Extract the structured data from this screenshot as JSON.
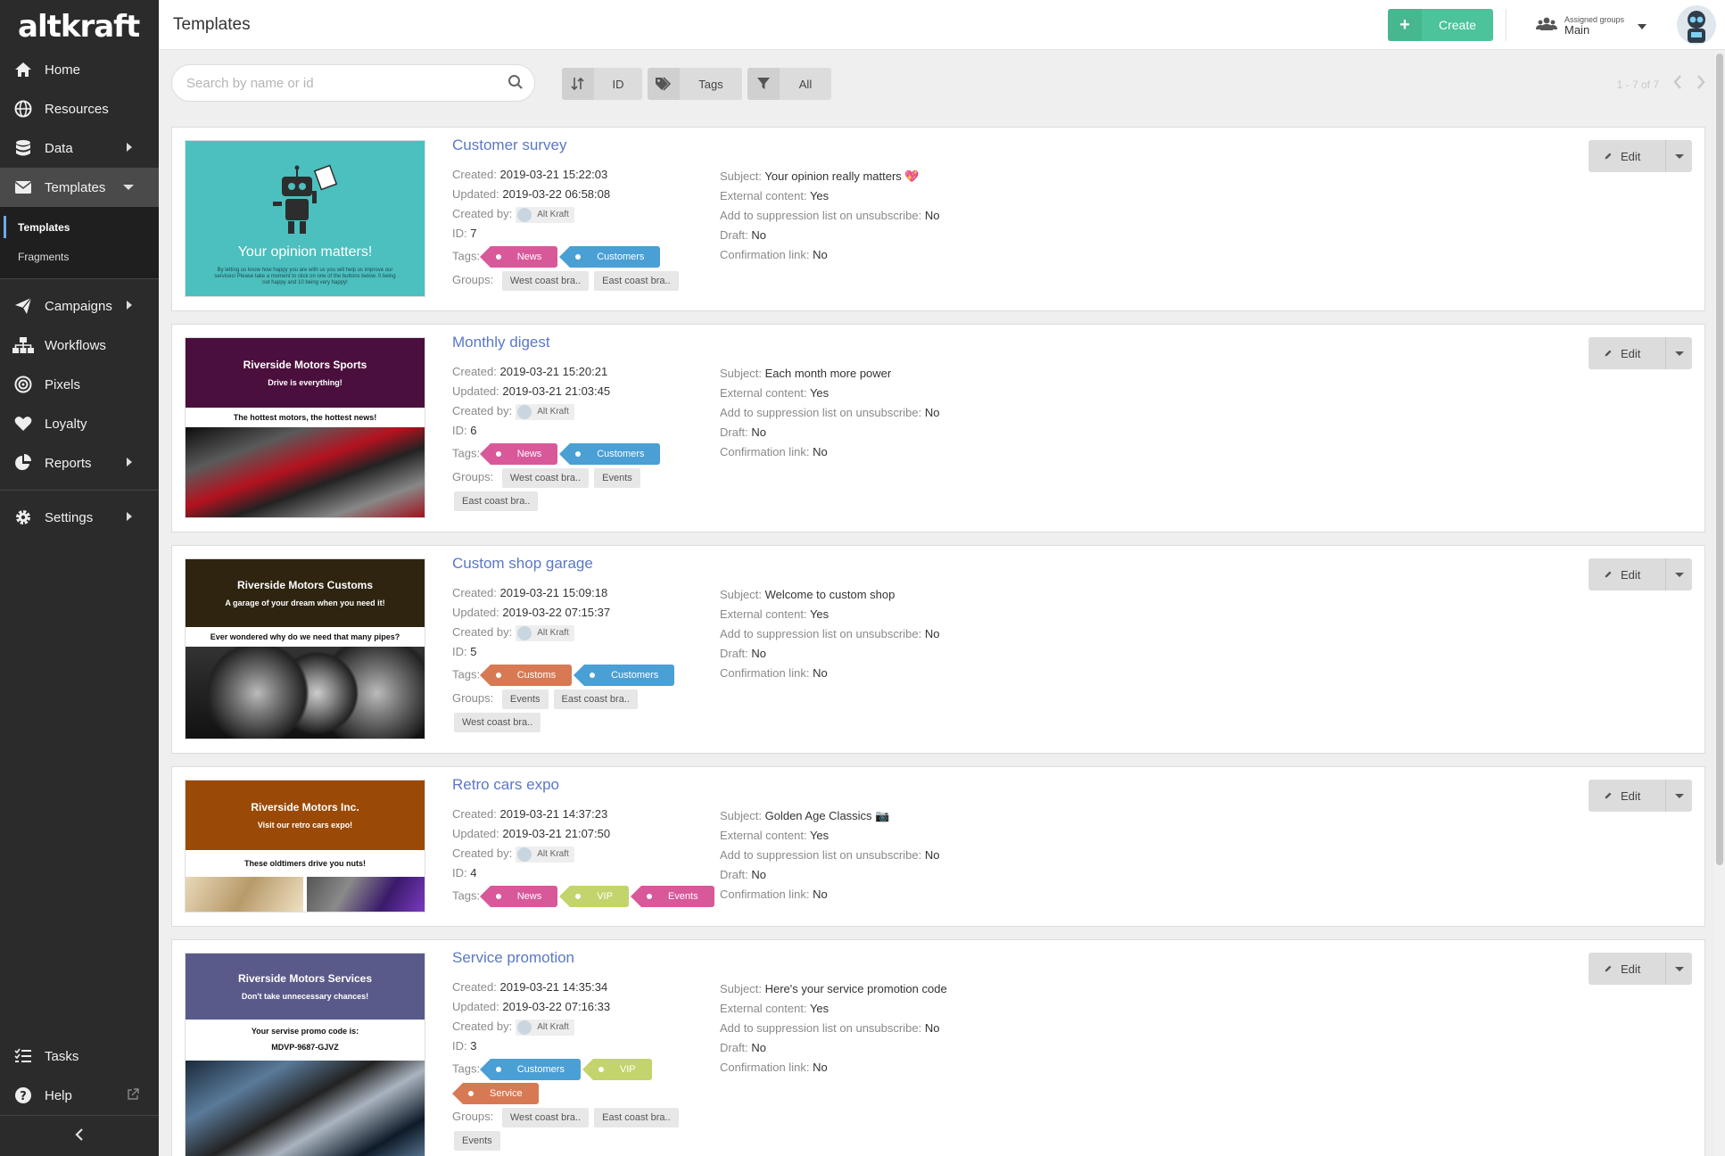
{
  "app": {
    "logo": "altkraft",
    "page_title": "Templates"
  },
  "sidebar": {
    "items": [
      {
        "label": "Home",
        "icon": "home-icon"
      },
      {
        "label": "Resources",
        "icon": "globe-icon"
      },
      {
        "label": "Data",
        "icon": "database-icon"
      },
      {
        "label": "Templates",
        "icon": "envelope-icon"
      },
      {
        "label": "Campaigns",
        "icon": "paper-plane-icon"
      },
      {
        "label": "Workflows",
        "icon": "sitemap-icon"
      },
      {
        "label": "Pixels",
        "icon": "target-icon"
      },
      {
        "label": "Loyalty",
        "icon": "heart-icon"
      },
      {
        "label": "Reports",
        "icon": "pie-chart-icon"
      },
      {
        "label": "Settings",
        "icon": "gear-icon"
      }
    ],
    "subitems": [
      {
        "label": "Templates"
      },
      {
        "label": "Fragments"
      }
    ],
    "bottom": [
      {
        "label": "Tasks",
        "icon": "tasks-icon"
      },
      {
        "label": "Help",
        "icon": "question-icon"
      }
    ]
  },
  "header": {
    "create_label": "Create",
    "groups_caption": "Assigned groups",
    "groups_value": "Main"
  },
  "toolbar": {
    "search_placeholder": "Search by name or id",
    "sort_label": "ID",
    "tags_label": "Tags",
    "filter_label": "All",
    "pager_text": "1 - 7 of 7"
  },
  "labels": {
    "created": "Created:",
    "updated": "Updated:",
    "created_by": "Created by:",
    "id": "ID:",
    "tags": "Tags:",
    "groups": "Groups:",
    "subject": "Subject:",
    "external": "External content:",
    "suppression": "Add to suppression list on unsubscribe:",
    "draft": "Draft:",
    "confirmation": "Confirmation link:",
    "edit": "Edit"
  },
  "colors": {
    "News": "#d9589a",
    "Customers": "#4a9fd5",
    "Customs": "#d77a54",
    "VIP": "#c3d46c",
    "Events": "#d9589a",
    "Service": "#d77a54"
  },
  "templates": [
    {
      "name": "Customer survey",
      "created": "2019-03-21 15:22:03",
      "updated": "2019-03-22 06:58:08",
      "created_by": "Alt Kraft",
      "id": "7",
      "tags": [
        "News",
        "Customers"
      ],
      "groups": [
        "West coast bra..",
        "East coast bra.."
      ],
      "subject": "Your opinion really matters 💖",
      "external": "Yes",
      "suppression": "No",
      "draft": "No",
      "confirmation": "No",
      "thumb": {
        "kind": "survey",
        "title": "Your opinion matters!",
        "text": "By letting us know how happy you are with us you will help us improve our services! Please take a moment to click on one of the buttons below. 0 being not happy and 10 being very happy!"
      }
    },
    {
      "name": "Monthly digest",
      "created": "2019-03-21 15:20:21",
      "updated": "2019-03-21 21:03:45",
      "created_by": "Alt Kraft",
      "id": "6",
      "tags": [
        "News",
        "Customers"
      ],
      "groups": [
        "West coast bra..",
        "Events",
        "East coast bra.."
      ],
      "subject": "Each month more power",
      "external": "Yes",
      "suppression": "No",
      "draft": "No",
      "confirmation": "No",
      "thumb": {
        "kind": "promo",
        "bg": "#4a0f3c",
        "title": "Riverside Motors Sports",
        "sub": "Drive is everything!",
        "blurb": "The hottest motors, the hottest news!"
      }
    },
    {
      "name": "Custom shop garage",
      "created": "2019-03-21 15:09:18",
      "updated": "2019-03-22 07:15:37",
      "created_by": "Alt Kraft",
      "id": "5",
      "tags": [
        "Customs",
        "Customers"
      ],
      "groups": [
        "Events",
        "East coast bra..",
        "West coast bra.."
      ],
      "subject": "Welcome to custom shop",
      "external": "Yes",
      "suppression": "No",
      "draft": "No",
      "confirmation": "No",
      "thumb": {
        "kind": "promo",
        "bg": "#2e2410",
        "title": "Riverside Motors Customs",
        "sub": "A garage of your dream when you need it!",
        "blurb": "Ever wondered why do we need that many pipes?"
      }
    },
    {
      "name": "Retro cars expo",
      "created": "2019-03-21 14:37:23",
      "updated": "2019-03-21 21:07:50",
      "created_by": "Alt Kraft",
      "id": "4",
      "tags": [
        "News",
        "VIP",
        "Events"
      ],
      "groups": [],
      "subject": "Golden Age Classics 📷",
      "external": "Yes",
      "suppression": "No",
      "draft": "No",
      "confirmation": "No",
      "thumb": {
        "kind": "promo",
        "bg": "#9a4a06",
        "title": "Riverside Motors Inc.",
        "sub": "Visit our retro cars expo!",
        "blurb": "These oldtimers drive you nuts!"
      }
    },
    {
      "name": "Service promotion",
      "created": "2019-03-21 14:35:34",
      "updated": "2019-03-22 07:16:33",
      "created_by": "Alt Kraft",
      "id": "3",
      "tags": [
        "Customers",
        "VIP",
        "Service"
      ],
      "groups": [
        "West coast bra..",
        "East coast bra..",
        "Events"
      ],
      "subject": "Here's your service promotion code",
      "external": "Yes",
      "suppression": "No",
      "draft": "No",
      "confirmation": "No",
      "thumb": {
        "kind": "promo",
        "bg": "#5a5a8a",
        "title": "Riverside Motors Services",
        "sub": "Don't take unnecessary chances!",
        "blurb": "Your servise promo code is:",
        "blurb2": "MDVP-9687-GJVZ"
      }
    }
  ]
}
